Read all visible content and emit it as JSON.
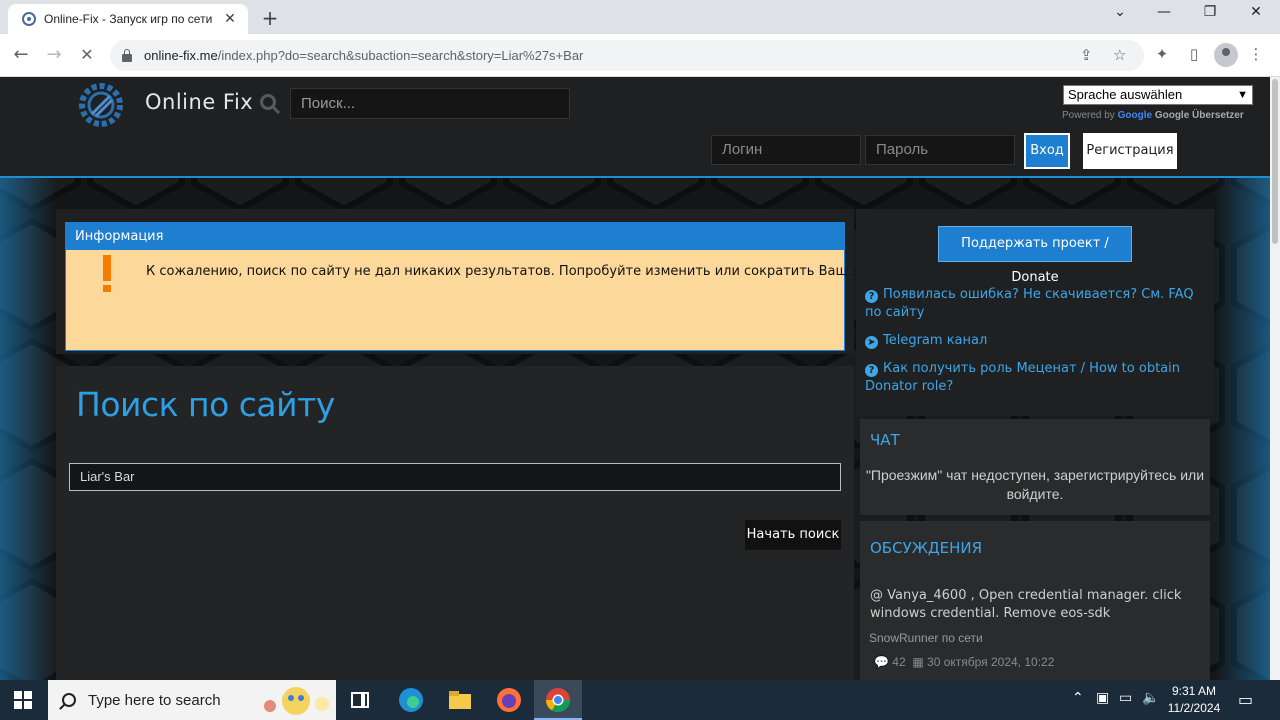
{
  "browser": {
    "tab_title": "Online-Fix - Запуск игр по сети",
    "tab_close": "✕",
    "new_tab": "+",
    "url_host": "online-fix.me",
    "url_path": "/index.php?do=search&subaction=search&story=Liar%27s+Bar"
  },
  "header": {
    "brand": "Online Fix",
    "search_placeholder": "Поиск...",
    "lang_select": "Sprache auswählen",
    "powered_by": "Powered by",
    "google": "Google",
    "translate": "Google Übersetzer",
    "login_placeholder": "Логин",
    "password_placeholder": "Пароль",
    "login_button": "Вход",
    "register_button": "Регистрация"
  },
  "info": {
    "heading": "Информация",
    "message": "К сожалению, поиск по сайту не дал никаких результатов. Попробуйте изменить или сократить Ваш запрос."
  },
  "search": {
    "title": "Поиск по сайту",
    "query": "Liar's Bar",
    "submit": "Начать поиск"
  },
  "sidebar": {
    "donate": "Поддержать проект / Donate",
    "links": [
      "Появилась ошибка? Не скачивается? См. FAQ по сайту",
      "Telegram канал",
      "Как получить роль Меценат / How to obtain Donator role?"
    ],
    "chat_title": "ЧАТ",
    "chat_text": "\"Проезжим\" чат недоступен, зарегистрируйтесь или войдите.",
    "discussions_title": "ОБСУЖДЕНИЯ",
    "discussion": {
      "text": "@ Vanya_4600 , Open credential manager. click windows credential. Remove eos-sdk",
      "topic": "SnowRunner по сети",
      "comments": "42",
      "date": "30 октября 2024, 10:22"
    }
  },
  "taskbar": {
    "search_text": "Type here to search",
    "time": "9:31 AM",
    "date": "11/2/2024"
  },
  "colors": {
    "accent_blue": "#1e7fd1",
    "title_blue": "#2f9fe3",
    "info_bg": "#fdd89b",
    "exclamation": "#f57c00"
  }
}
